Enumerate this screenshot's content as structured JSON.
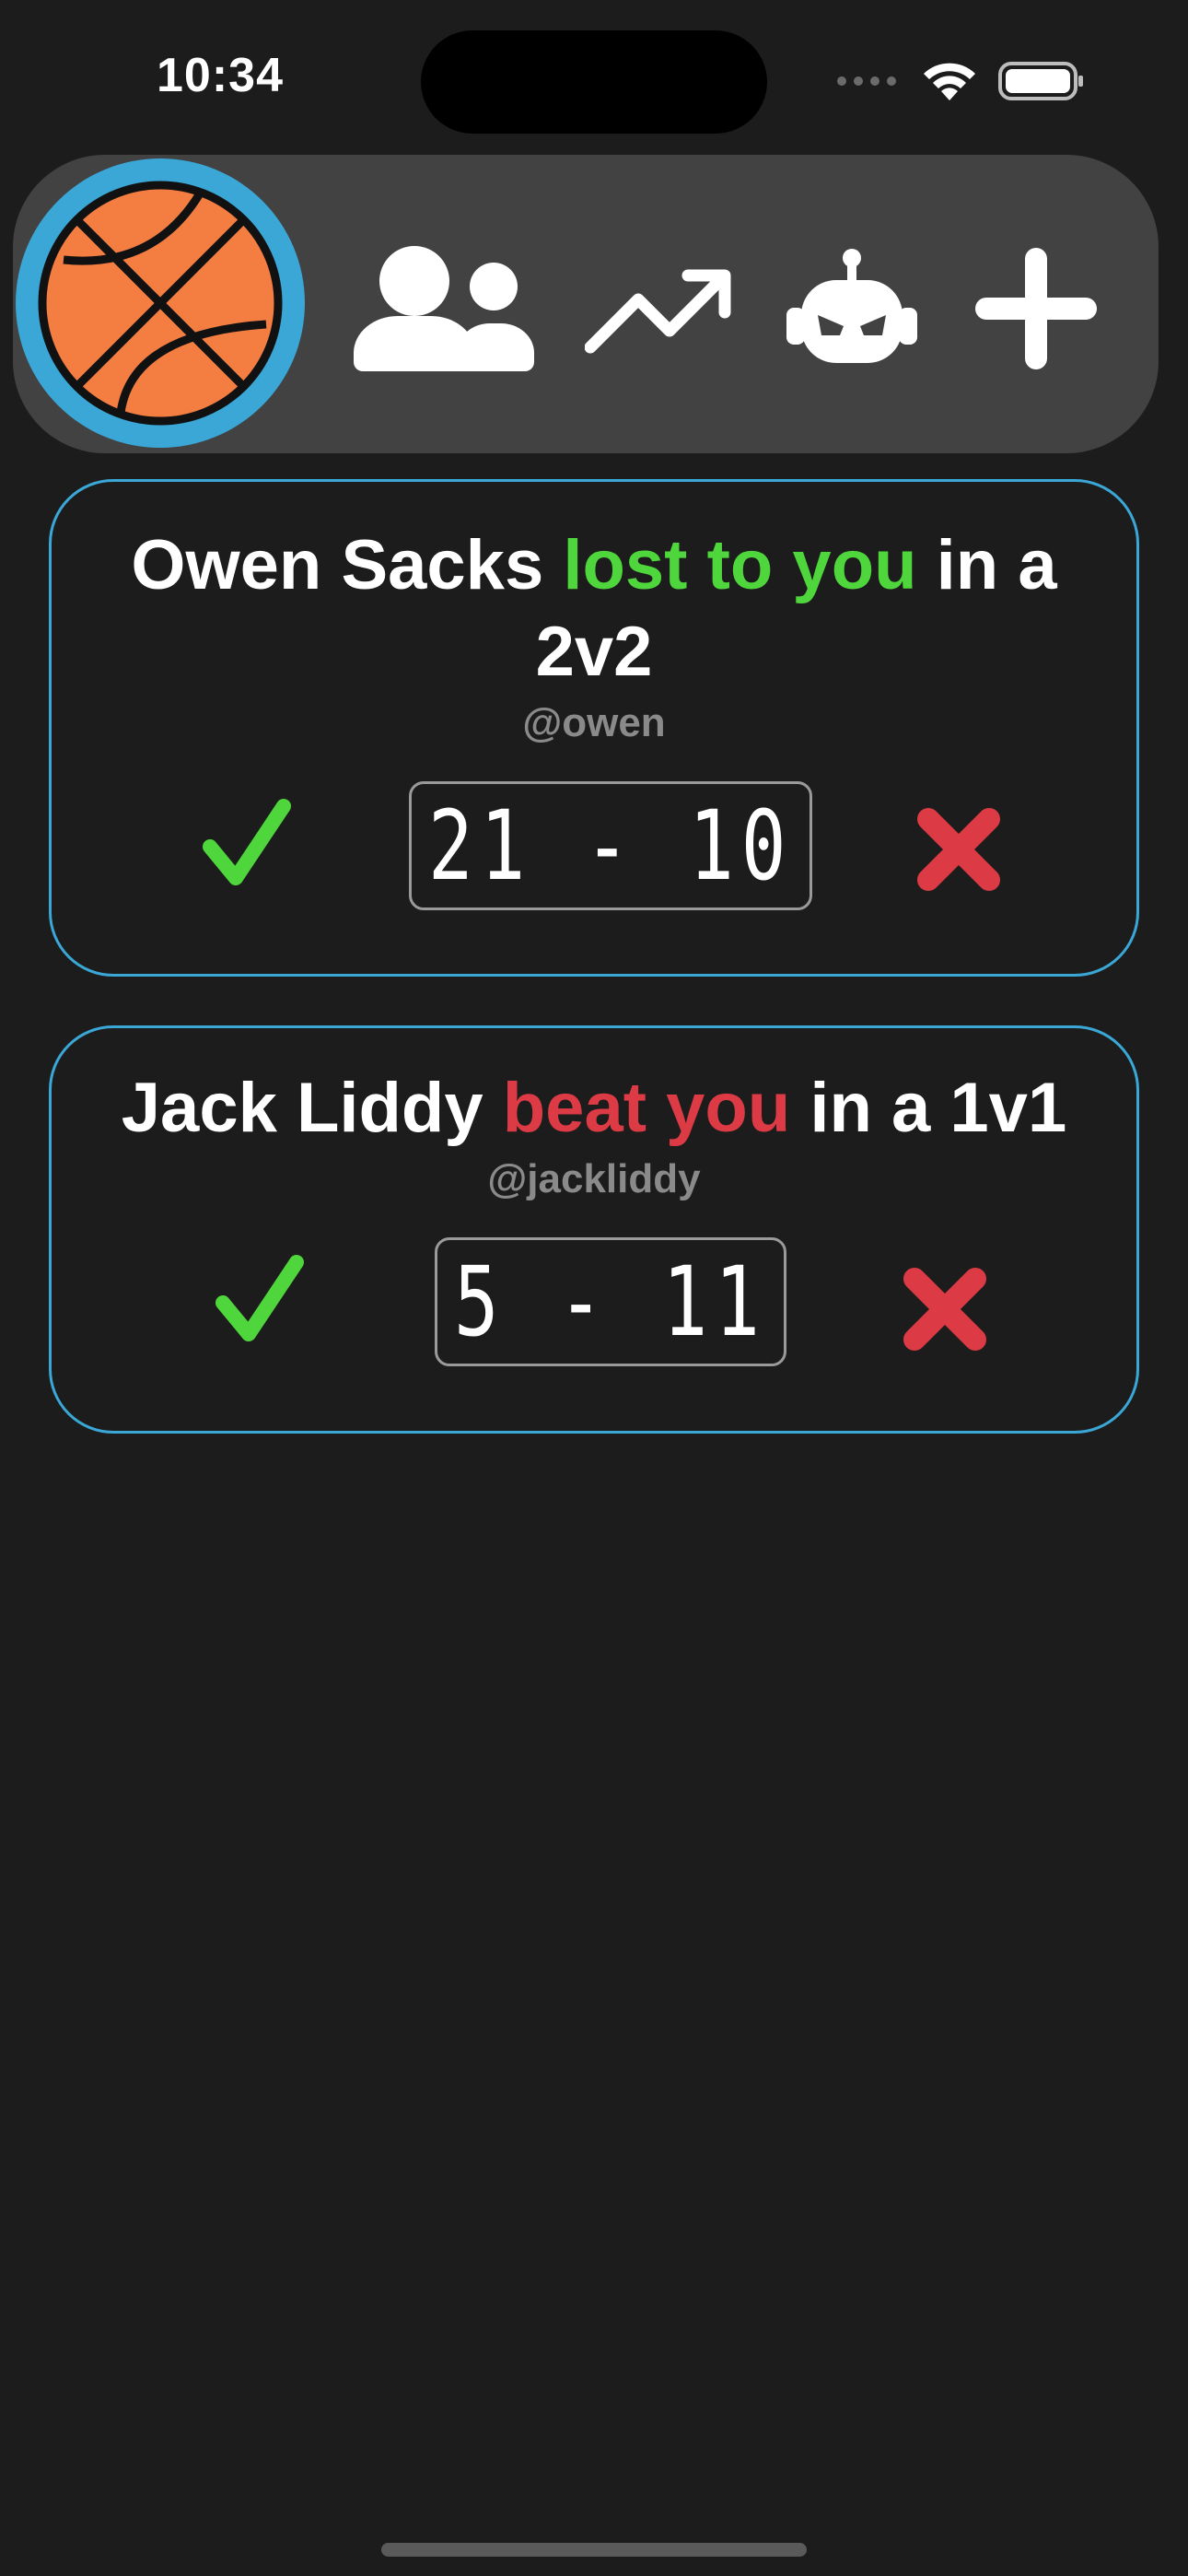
{
  "status_bar": {
    "time": "10:34"
  },
  "toolbar": {
    "icons": [
      "basketball-logo",
      "friends-icon",
      "trending-icon",
      "bot-icon",
      "plus-icon"
    ]
  },
  "games": [
    {
      "name": "Owen Sacks",
      "result": "lost to you",
      "mode_text": "in a 2v2",
      "handle": "@owen",
      "score": "21 - 10",
      "result_color": "#4fd63c"
    },
    {
      "name": "Jack Liddy",
      "result": "beat you",
      "mode_text": "in a 1v1",
      "handle": "@jackliddy",
      "score": "5 - 11",
      "result_color": "#dc3b45"
    }
  ],
  "colors": {
    "background": "#1c1c1c",
    "toolbar": "#424242",
    "card_border": "#3aa7d7",
    "accept": "#4fd63c",
    "reject": "#dc3b45",
    "basketball": "#f47e42"
  }
}
